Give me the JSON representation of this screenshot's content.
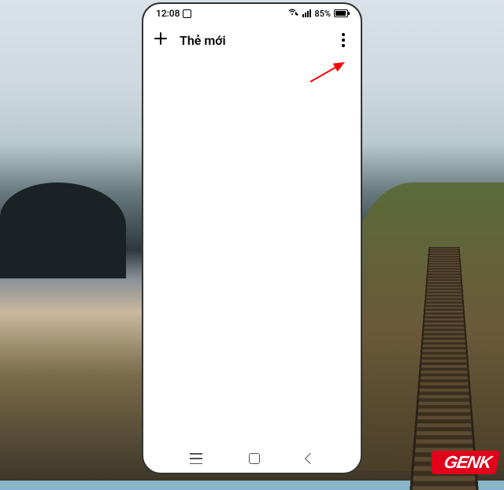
{
  "status": {
    "time": "12:08",
    "battery_pct": "85%"
  },
  "toolbar": {
    "title": "Thẻ mới"
  },
  "watermark": {
    "text": "GENK"
  }
}
